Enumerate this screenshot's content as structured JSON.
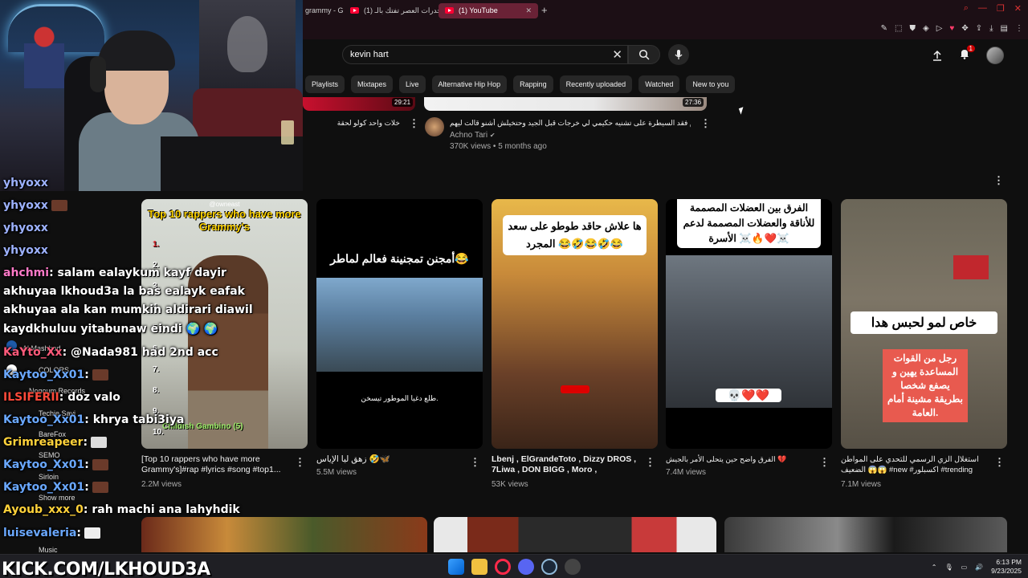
{
  "browser": {
    "tabs": [
      {
        "label": "grammy - G",
        "active": false
      },
      {
        "label": "(1) مخدرات العصر تفتك بالـ",
        "active": false
      },
      {
        "label": "(1) YouTube",
        "active": true
      }
    ],
    "new_tab": "+"
  },
  "youtube": {
    "search_value": "kevin hart",
    "notifications_count": "1",
    "chips": [
      "Playlists",
      "Mixtapes",
      "Live",
      "Alternative Hip Hop",
      "Rapping",
      "Recently uploaded",
      "Watched",
      "New to you"
    ],
    "top_row": [
      {
        "duration": "29:21",
        "title": "خلات واحد كولو لحقة"
      },
      {
        "duration": "27:36",
        "title": "بدام فقد السيطرة على تشنيه حكيمي لي خرجات قبل الجيد وحتخيلش أشنو قالت ليهم",
        "channel": "Achno Tari",
        "views": "370K views • 5 months ago"
      }
    ],
    "shorts": [
      {
        "title": "[Top 10 rappers who have more Grammy's]#rap #lyrics #song #top1...",
        "views": "2.2M views",
        "thumb_text": "Top 10 rappers who have more Grammy's",
        "thumb_handle": "@owneast",
        "thumb_caption": "Childish Gambino (5)",
        "numbers": [
          "1.",
          "2.",
          "3.",
          "4.",
          "5.",
          "6.",
          "7.",
          "8.",
          "9.",
          "10."
        ]
      },
      {
        "title": "زهق ليا الإياس 🤣🦋",
        "views": "5.5M views",
        "thumb_text": "أمجنن تمجنينة فعالم لماطر😂",
        "thumb_caption": "طلع دغيا الموطور تيسخن."
      },
      {
        "title": "Lbenj , ElGrandeToto , Dizzy DROS , 7Liwa , DON BIGG , Moro , DRAGANO...",
        "views": "53K views",
        "thumb_text": "ها علاش حاقد طوطو على سعد المجرد 😂🤣😂🤣😂"
      },
      {
        "title": "الفرق واضح حين يتحلى الأمر بالجيش 💔",
        "views": "7.4M views",
        "thumb_text": "الفرق بين العضلات المصممة للأناقة والعضلات المصممة لدعم الأسرة ☠️🔥❤️☠️",
        "thumb_caption": "💀❤️❤️"
      },
      {
        "title": "استغلال الزي الرسمي للتحدي على المواطن الضعيف 😱😱 #new #اكسبلور #trending #tiktok",
        "views": "7.1M views",
        "thumb_text": "خاص لمو لحبس هدا",
        "thumb_caption": "رجل من القوات المساعدة يهين و يصفع شخصا بطريقة مشينة أمام العامة."
      }
    ]
  },
  "chat": {
    "lines": [
      {
        "user": "yhyoxx",
        "text": ""
      },
      {
        "user": "yhyoxx",
        "text": ""
      },
      {
        "user": "yhyoxx",
        "text": ""
      },
      {
        "user": "yhyoxx",
        "text": ""
      },
      {
        "user": "ahchmi",
        "text": ": salam ealaykum kayf dayir"
      },
      {
        "user": "",
        "text": "akhuyaa lkhoud3a la bas ealayk eafak"
      },
      {
        "user": "",
        "text": "akhuyaa ala kan mumkin aldirari diawil"
      },
      {
        "user": "",
        "text": "kaydkhuluu yitabunaw eindi 🌍 🌍"
      },
      {
        "user": "KaYto_Xx",
        "text": ": @Nada981 had 2nd acc"
      },
      {
        "user": "Kaytoo_Xx01",
        "text": ":"
      },
      {
        "user": "ILSIFERII",
        "text": ": doz valo"
      },
      {
        "user": "Kaytoo_Xx01",
        "text": ": khrya tabi3iya"
      },
      {
        "user": "Grimreapeer",
        "text": ":"
      },
      {
        "user": "Kaytoo_Xx01",
        "text": ":"
      },
      {
        "user": "Kaytoo_Xx01",
        "text": ":"
      },
      {
        "user": "Ayoub_xxx_0",
        "text": ": rah machi ana lahyhdik"
      },
      {
        "user": "luisevaleria",
        "text": ":"
      }
    ],
    "sidebar": [
      "Al Mashhad",
      "COLORS",
      "Nogoum Records",
      "Techie Savi",
      "BareFox",
      "SEMO",
      "Sirloin",
      "Show more",
      "Music"
    ]
  },
  "watermark": "KICK.COM/LKHOUD3A",
  "taskbar": {
    "time": "6:13 PM",
    "date": "9/23/2025"
  }
}
